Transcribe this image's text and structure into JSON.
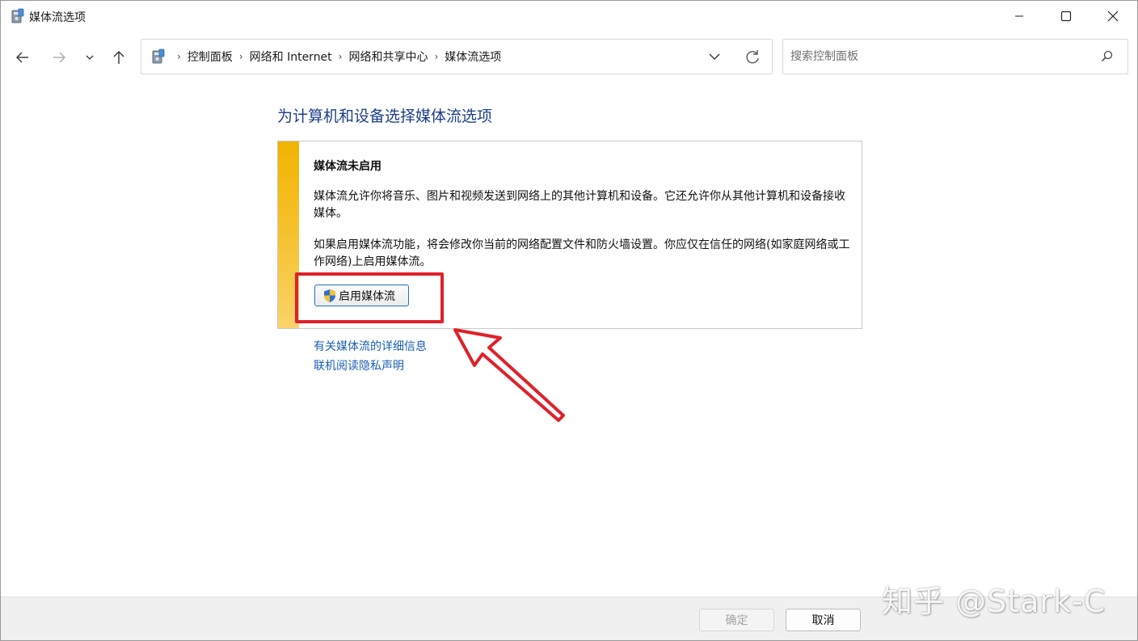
{
  "window": {
    "title": "媒体流选项",
    "icon": "control-panel-icon"
  },
  "nav": {
    "breadcrumbs": [
      "控制面板",
      "网络和 Internet",
      "网络和共享中心",
      "媒体流选项"
    ],
    "search_placeholder": "搜索控制面板"
  },
  "main": {
    "title": "为计算机和设备选择媒体流选项",
    "notice": {
      "heading": "媒体流未启用",
      "paragraph1": "媒体流允许你将音乐、图片和视频发送到网络上的其他计算机和设备。它还允许你从其他计算机和设备接收媒体。",
      "paragraph2": "如果启用媒体流功能，将会修改你当前的网络配置文件和防火墙设置。你应仅在信任的网络(如家庭网络或工作网络)上启用媒体流。",
      "enable_button": "启用媒体流",
      "accent_color": "#f2b300"
    },
    "links": [
      "有关媒体流的详细信息",
      "联机阅读隐私声明"
    ]
  },
  "footer": {
    "ok_label": "确定",
    "cancel_label": "取消"
  },
  "overlay": {
    "watermark": "知乎 @Stark-C",
    "highlight_color": "#e0212b"
  }
}
